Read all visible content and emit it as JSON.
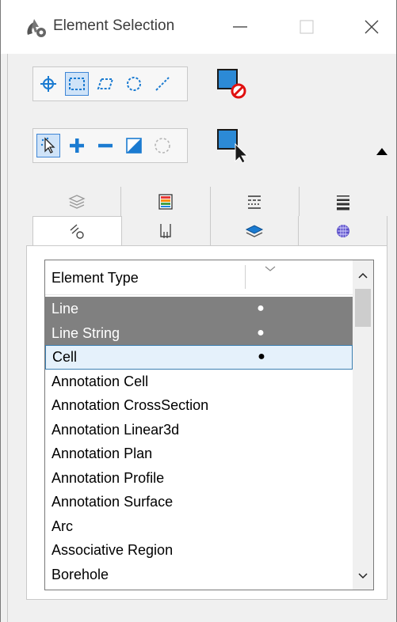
{
  "window": {
    "title": "Element Selection",
    "controls": [
      "minimize",
      "maximize",
      "close"
    ]
  },
  "toolbar": {
    "method_tools": [
      {
        "icon": "crosshair-icon",
        "active": false
      },
      {
        "icon": "block-select-icon",
        "active": true
      },
      {
        "icon": "shape-select-icon",
        "active": false
      },
      {
        "icon": "circle-select-icon",
        "active": false
      },
      {
        "icon": "line-select-icon",
        "active": false
      }
    ],
    "mode_tools": [
      {
        "icon": "new-selection-icon",
        "active": true
      },
      {
        "icon": "add-icon",
        "active": false
      },
      {
        "icon": "subtract-icon",
        "active": false
      },
      {
        "icon": "invert-icon",
        "active": false
      },
      {
        "icon": "clear-icon",
        "active": false
      }
    ],
    "right_buttons": [
      "clear-selection-icon",
      "select-all-icon"
    ]
  },
  "tabs_row1": [
    "levels-icon",
    "color-icon",
    "line-style-icon",
    "weight-icon"
  ],
  "tabs_row2": [
    "type-icon",
    "class-icon",
    "template-icon",
    "material-icon"
  ],
  "list": {
    "column_header": "Element Type",
    "rows": [
      {
        "label": "Line",
        "marked": true,
        "state": "selected"
      },
      {
        "label": "Line String",
        "marked": true,
        "state": "selected"
      },
      {
        "label": "Cell",
        "marked": true,
        "state": "focused"
      },
      {
        "label": "Annotation Cell",
        "marked": false,
        "state": "normal"
      },
      {
        "label": "Annotation CrossSection",
        "marked": false,
        "state": "normal"
      },
      {
        "label": "Annotation Linear3d",
        "marked": false,
        "state": "normal"
      },
      {
        "label": "Annotation Plan",
        "marked": false,
        "state": "normal"
      },
      {
        "label": "Annotation Profile",
        "marked": false,
        "state": "normal"
      },
      {
        "label": "Annotation Surface",
        "marked": false,
        "state": "normal"
      },
      {
        "label": "Arc",
        "marked": false,
        "state": "normal"
      },
      {
        "label": "Associative Region",
        "marked": false,
        "state": "normal"
      },
      {
        "label": "Borehole",
        "marked": false,
        "state": "normal"
      }
    ]
  },
  "colors": {
    "selected_row": "#808080",
    "focus_row": "#e5f1fb",
    "accent_blue": "#1b7bd1"
  }
}
